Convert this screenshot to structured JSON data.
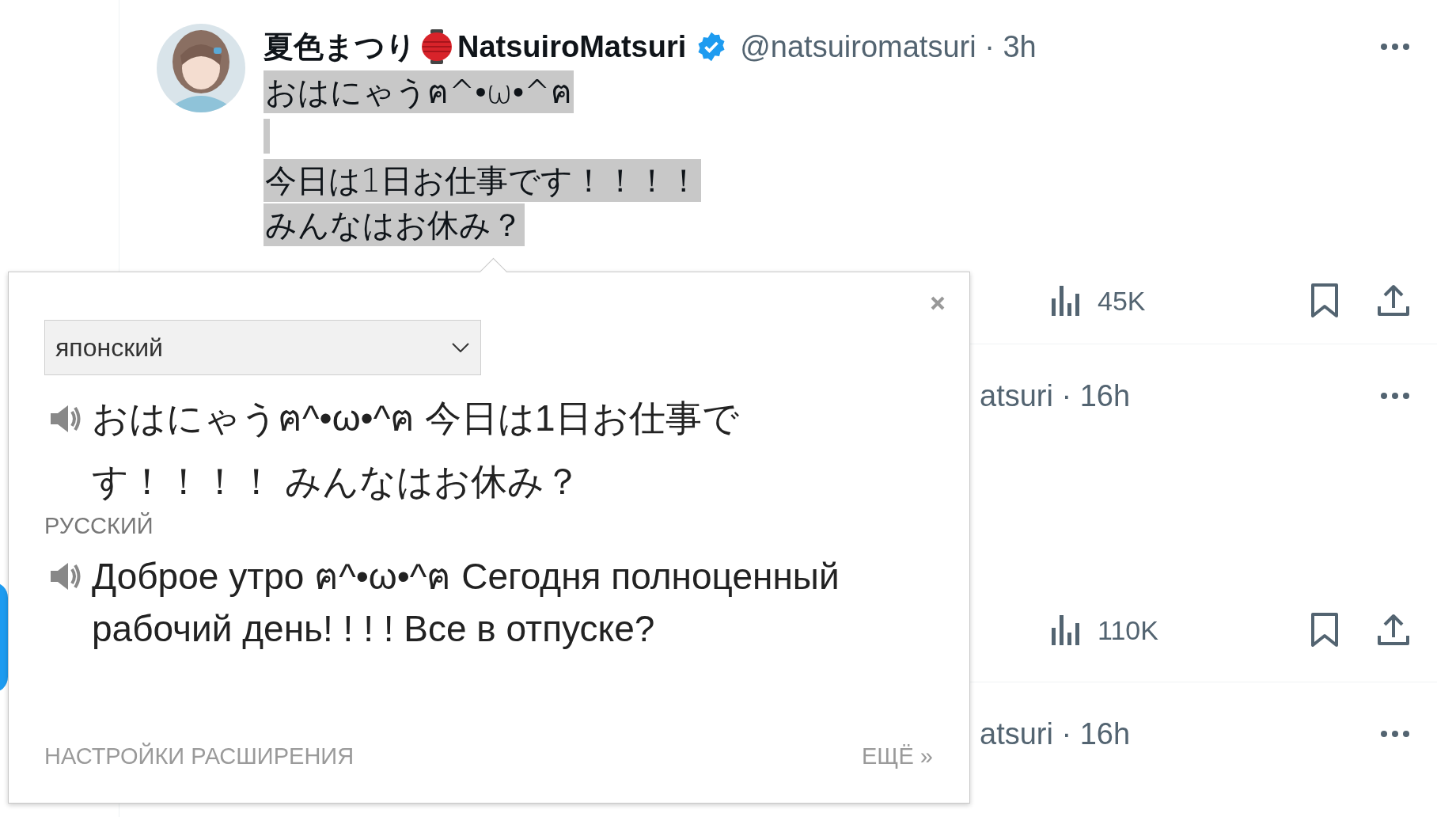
{
  "tweets": [
    {
      "kind": "full",
      "display_name": "夏色まつり",
      "name_latin": "NatsuiroMatsuri",
      "verified": true,
      "handle_time": "@natsuiromatsuri · 3h",
      "highlighted": true,
      "paragraphs": [
        [
          "おはにゃうฅ^•ω•^ฅ"
        ],
        [
          "今日は1日お仕事です！！！！",
          "みんなはお休み？"
        ]
      ],
      "views": "45K"
    },
    {
      "kind": "covered",
      "handle_time": "atsuri · 16h",
      "views": "110K"
    },
    {
      "kind": "covered",
      "handle_time": "atsuri · 16h"
    }
  ],
  "translator": {
    "source_language": "японский",
    "source_text": "おはにゃうฅ^•ω•^ฅ 今日は1日お仕事です！！！！ みんなはお休み？",
    "target_language": "РУССКИЙ",
    "translation": "Доброе утро ฅ^•ω•^ฅ Сегодня полноценный рабочий день! ! ! ! Все в отпуске?",
    "settings_link": "НАСТРОЙКИ РАСШИРЕНИЯ",
    "more_link": "ЕЩЁ »"
  }
}
